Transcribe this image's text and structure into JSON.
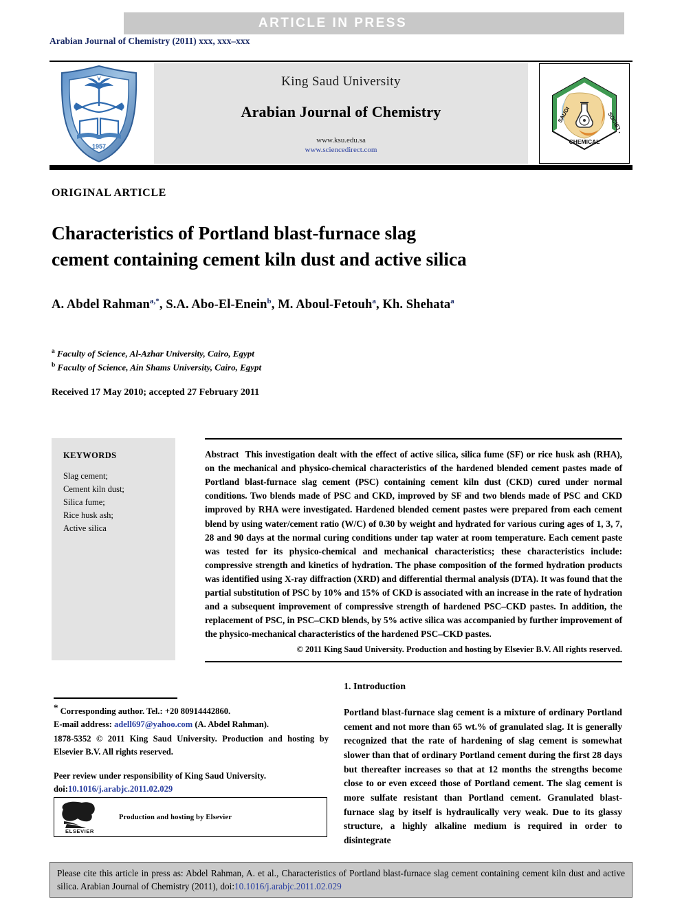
{
  "banner": {
    "label": "ARTICLE  IN  PRESS"
  },
  "journal_line": {
    "name": "Arabian Journal of Chemistry (2011)",
    "pages": "xxx, xxx–xxx"
  },
  "masthead": {
    "publisher": "King Saud University",
    "journal_title": "Arabian Journal of Chemistry",
    "url_primary": "www.ksu.edu.sa",
    "url_secondary": "www.sciencedirect.com",
    "left_logo_name": "king-saud-university-shield-logo",
    "right_logo_name": "saudi-chemical-society-hexagon-logo"
  },
  "article": {
    "type_label": "ORIGINAL ARTICLE",
    "title_line1": "Characteristics of Portland blast-furnace slag",
    "title_line2": "cement containing cement kiln dust and active silica",
    "authors": [
      {
        "name": "A. Abdel Rahman",
        "marks": "a,*"
      },
      {
        "name": "S.A. Abo-El-Enein",
        "marks": "b"
      },
      {
        "name": "M. Aboul-Fetouh",
        "marks": "a"
      },
      {
        "name": "Kh. Shehata",
        "marks": "a"
      }
    ],
    "affiliations": [
      {
        "mark": "a",
        "text": "Faculty of Science, Al-Azhar University, Cairo, Egypt"
      },
      {
        "mark": "b",
        "text": "Faculty of Science, Ain Shams University, Cairo, Egypt"
      }
    ],
    "history": "Received 17 May 2010; accepted 27 February 2011"
  },
  "keywords": {
    "heading": "KEYWORDS",
    "items": [
      "Slag cement;",
      "Cement kiln dust;",
      "Silica fume;",
      "Rice husk ash;",
      "Active silica"
    ]
  },
  "abstract": {
    "label": "Abstract",
    "text": "This investigation dealt with the effect of active silica, silica fume (SF) or rice husk ash (RHA), on the mechanical and physico-chemical characteristics of the hardened blended cement pastes made of Portland blast-furnace slag cement (PSC) containing cement kiln dust (CKD) cured under normal conditions. Two blends made of PSC and CKD, improved by SF and two blends made of PSC and CKD improved by RHA were investigated. Hardened blended cement pastes were prepared from each cement blend by using water/cement ratio (W/C) of 0.30 by weight and hydrated for various curing ages of 1, 3, 7, 28 and 90 days at the normal curing conditions under tap water at room temperature. Each cement paste was tested for its physico-chemical and mechanical characteristics; these characteristics include: compressive strength and kinetics of hydration. The phase composition of the formed hydration products was identified using X-ray diffraction (XRD) and differential thermal analysis (DTA). It was found that the partial substitution of PSC by 10% and 15% of CKD is associated with an increase in the rate of hydration and a subsequent improvement of compressive strength of hardened PSC–CKD pastes. In addition, the replacement of PSC, in PSC–CKD blends, by 5% active silica was accompanied by further improvement of the physico-mechanical characteristics of the hardened PSC–CKD pastes.",
    "copyright": "© 2011 King Saud University. Production and hosting by Elsevier B.V. All rights reserved."
  },
  "footer": {
    "corresponding_note": "Corresponding author. Tel.: +20 80914442860.",
    "email_label": "E-mail address:",
    "email": "adell697@yahoo.com",
    "email_owner": "(A. Abdel Rahman).",
    "issn_copyright": "1878-5352 © 2011 King Saud University. Production and hosting by Elsevier B.V. All rights reserved.",
    "peer_review": "Peer review under responsibility of King Saud University.",
    "doi_label": "doi:",
    "doi": "10.1016/j.arabjc.2011.02.029",
    "elsevier_caption": "Production and hosting by Elsevier",
    "elsevier_wordmark": "ELSEVIER"
  },
  "introduction": {
    "heading": "1. Introduction",
    "text": "Portland blast-furnace slag cement is a mixture of ordinary Portland cement and not more than 65 wt.% of granulated slag. It is generally recognized that the rate of hardening of slag cement is somewhat slower than that of ordinary Portland cement during the first 28 days but thereafter increases so that at 12 months the strengths become close to or even exceed those of Portland cement. The slag cement is more sulfate resistant than Portland cement. Granulated blast-furnace slag by itself is hydraulically very weak. Due to its glassy structure, a highly alkaline medium is required in order to disintegrate"
  },
  "cite_box": {
    "text_before_doi": "Please cite this article in press as: Abdel Rahman, A. et al., Characteristics of Portland blast-furnace slag cement containing cement kiln dust and active silica. Arabian Journal of Chemistry (2011), doi:",
    "doi": "10.1016/j.arabjc.2011.02.029"
  },
  "colors": {
    "banner_gray": "#c8c8c8",
    "panel_gray": "#e3e3e3",
    "link_blue": "#2a3fa0",
    "cite_gray": "#c9c9c9"
  }
}
